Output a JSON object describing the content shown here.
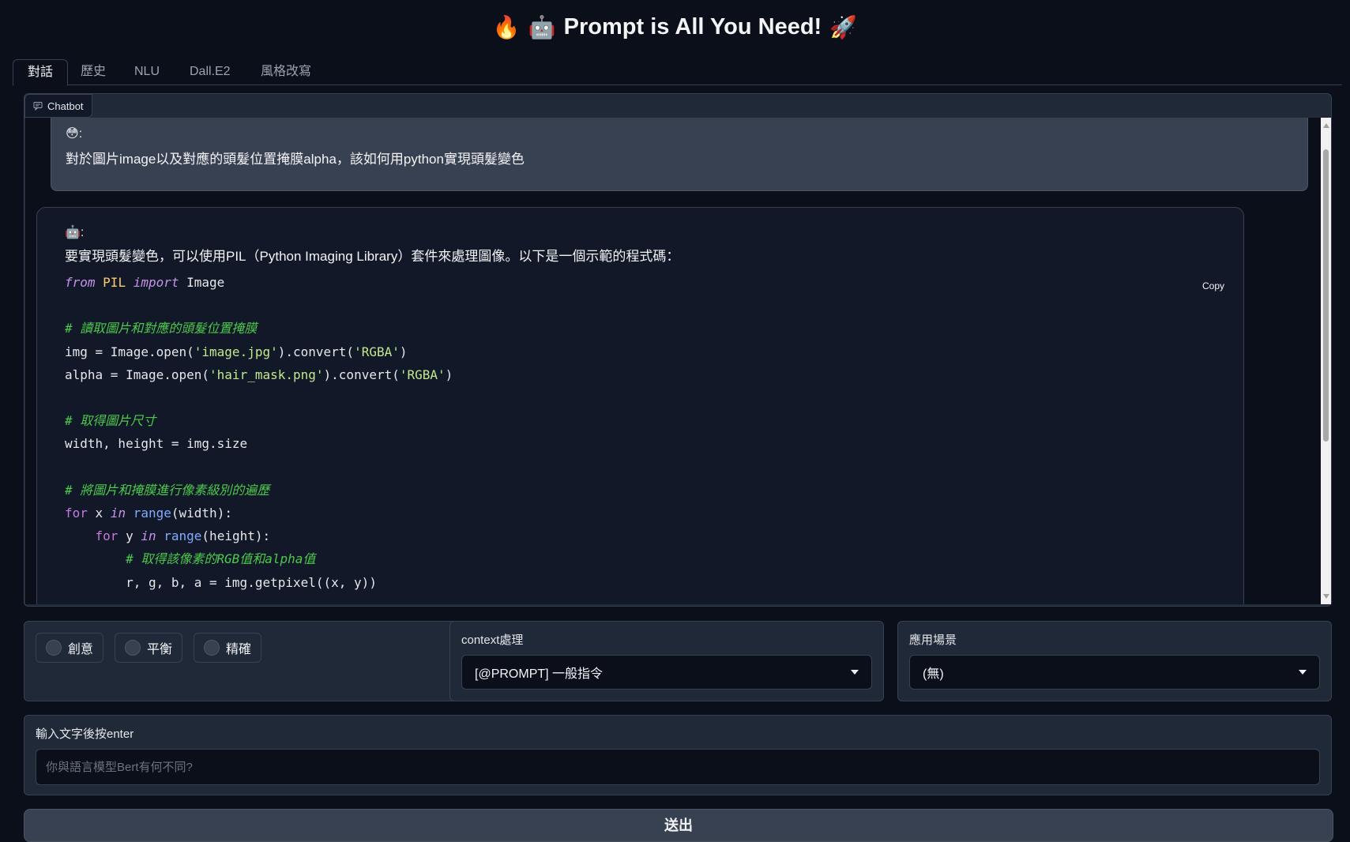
{
  "header": {
    "title": "Prompt is All You Need!",
    "emoji_left": [
      "🔥",
      "🤖"
    ],
    "emoji_right": "🚀"
  },
  "tabs": [
    "對話",
    "歷史",
    "NLU",
    "Dall.E2",
    "風格改寫"
  ],
  "chatbot": {
    "label": "Chatbot",
    "user_message": {
      "icon": "😳",
      "text": "對於圖片image以及對應的頭髮位置掩膜alpha，該如何用python實現頭髮變色"
    },
    "bot_message": {
      "icon": "🤖",
      "intro": "要實現頭髮變色，可以使用PIL（Python Imaging Library）套件來處理圖像。以下是一個示範的程式碼：",
      "copy_label": "Copy",
      "code_comments": [
        "# 讀取圖片和對應的頭髮位置掩膜",
        "# 取得圖片尺寸",
        "# 將圖片和掩膜進行像素級別的遍歷",
        "# 取得該像素的RGB值和alpha值"
      ]
    }
  },
  "controls": {
    "radios": [
      "創意",
      "平衡",
      "精確"
    ],
    "context": {
      "label": "context處理",
      "value": "[@PROMPT] 一般指令"
    },
    "scene": {
      "label": "應用場景",
      "value": "(無)"
    }
  },
  "input": {
    "label": "輸入文字後按enter",
    "placeholder": "你與語言模型Bert有何不同?"
  },
  "submit_label": "送出"
}
